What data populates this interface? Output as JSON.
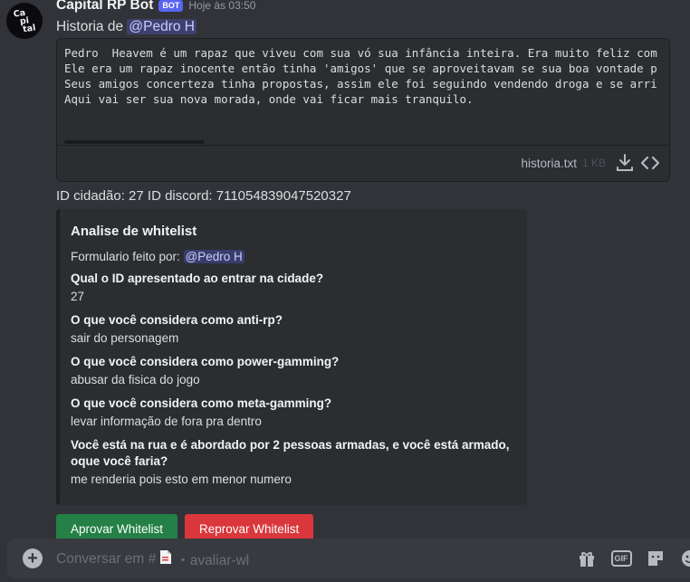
{
  "message": {
    "avatar_lines": [
      "Ca",
      "pi",
      "tal"
    ],
    "username": "Capital RP Bot",
    "badge": "BOT",
    "timestamp": "Hoje às 03:50",
    "text_prefix": "Historia de",
    "mention": "@Pedro  H",
    "id_line": "ID cidadão: 27 ID discord: 711054839047520327"
  },
  "attachment": {
    "lines": [
      "Pedro  Heavem é um rapaz que viveu com sua vó sua infância inteira. Era muito feliz com",
      "Ele era um rapaz inocente então tinha 'amigos' que se aproveitavam se sua boa vontade p",
      "Seus amigos concerteza tinha propostas, assim ele foi seguindo vendendo droga e se arri",
      "Aqui vai ser sua nova morada, onde vai ficar mais tranquilo."
    ],
    "file_name": "historia.txt",
    "file_size": "1 KB",
    "icons": [
      "download-icon",
      "code-icon"
    ]
  },
  "embed": {
    "title": "Analise de whitelist",
    "desc_prefix": "Formulario feito por:",
    "desc_mention": "@Pedro H",
    "fields": [
      {
        "q": "Qual o ID apresentado ao entrar na cidade?",
        "a": "27"
      },
      {
        "q": "O que você considera como anti-rp?",
        "a": "sair do personagem"
      },
      {
        "q": "O que você considera como power-gamming?",
        "a": "abusar da fisica do jogo"
      },
      {
        "q": "O que você considera como meta-gamming?",
        "a": "levar informação de fora pra dentro"
      },
      {
        "q": "Você está na rua e é abordado por 2 pessoas armadas, e você está armado, oque você faria?",
        "a": "me renderia pois esto em menor numero"
      }
    ]
  },
  "buttons": {
    "approve": "Aprovar Whitelist",
    "reject": "Reprovar Whitelist",
    "approve_color": "#248046",
    "reject_color": "#da373c"
  },
  "composer": {
    "prefix": "Conversar em #",
    "channel": "・avaliar-wl",
    "icons": [
      "add-icon",
      "channel-doc-icon",
      "gift-icon",
      "gif-icon",
      "sticker-icon",
      "emoji-icon"
    ],
    "gif_label": "GIF"
  }
}
